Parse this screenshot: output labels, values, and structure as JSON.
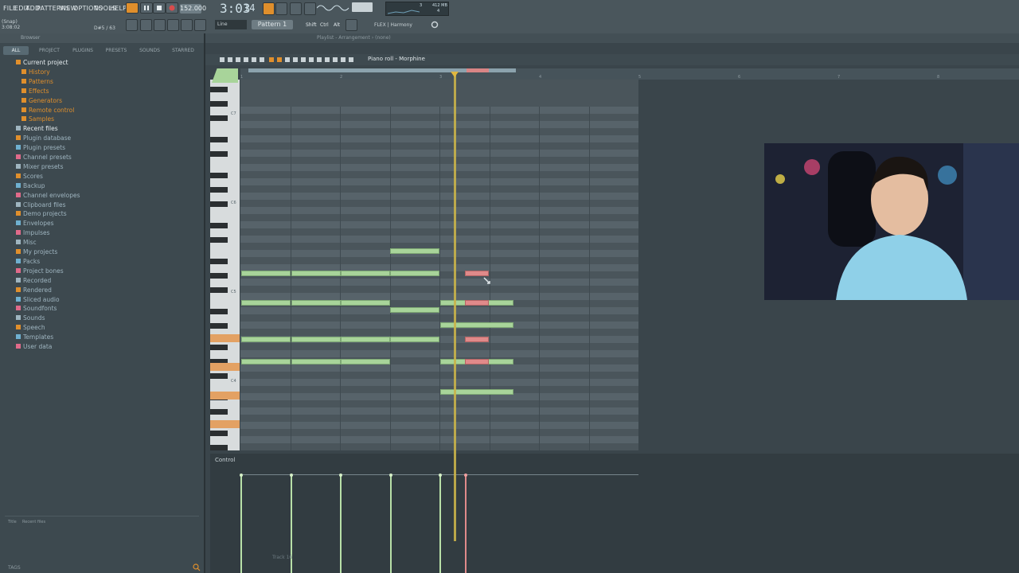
{
  "menu": [
    "FILE",
    "EDIT",
    "ADD",
    "PATTERNS",
    "VIEW",
    "OPTIONS",
    "TOOLS",
    "HELP"
  ],
  "transport": {
    "tempo": "152.000",
    "time": "3:03",
    "time_sub": "14",
    "cpu": "3",
    "ram": "412 MB",
    "voices": "4"
  },
  "pattern_label": "Pattern 1",
  "snap_label": "Line",
  "hint": {
    "line1": "(Snap)",
    "line2": "3:08:02",
    "value": "D#5 / 63"
  },
  "toolbar_keys": [
    "Shift",
    "Ctrl",
    "Alt"
  ],
  "flex_label": "FLEX | Harmony",
  "browser": {
    "title": "Browser",
    "tabs": [
      "ALL",
      "PROJECT",
      "PLUGINS",
      "PRESETS",
      "SOUNDS",
      "STARRED"
    ],
    "items": [
      {
        "label": "Current project",
        "level": 0,
        "color": "#e08f2c"
      },
      {
        "label": "History",
        "level": 1
      },
      {
        "label": "Patterns",
        "level": 1
      },
      {
        "label": "Effects",
        "level": 1
      },
      {
        "label": "Generators",
        "level": 1
      },
      {
        "label": "Remote control",
        "level": 1
      },
      {
        "label": "Samples",
        "level": 1
      },
      {
        "label": "Recent files",
        "level": 0
      },
      {
        "label": "Plugin database",
        "level": 0
      },
      {
        "label": "Plugin presets",
        "level": 0
      },
      {
        "label": "Channel presets",
        "level": 0
      },
      {
        "label": "Mixer presets",
        "level": 0
      },
      {
        "label": "Scores",
        "level": 0
      },
      {
        "label": "Backup",
        "level": 0
      },
      {
        "label": "Channel envelopes",
        "level": 0
      },
      {
        "label": "Clipboard files",
        "level": 0
      },
      {
        "label": "Demo projects",
        "level": 0
      },
      {
        "label": "Envelopes",
        "level": 0
      },
      {
        "label": "Impulses",
        "level": 0
      },
      {
        "label": "Misc",
        "level": 0
      },
      {
        "label": "My projects",
        "level": 0
      },
      {
        "label": "Packs",
        "level": 0
      },
      {
        "label": "Project bones",
        "level": 0
      },
      {
        "label": "Recorded",
        "level": 0
      },
      {
        "label": "Rendered",
        "level": 0
      },
      {
        "label": "Sliced audio",
        "level": 0
      },
      {
        "label": "Soundfonts",
        "level": 0
      },
      {
        "label": "Sounds",
        "level": 0
      },
      {
        "label": "Speech",
        "level": 0
      },
      {
        "label": "Templates",
        "level": 0
      },
      {
        "label": "User data",
        "level": 0
      }
    ],
    "footer": {
      "title": "Title",
      "recent": "Recent files",
      "tags": "TAGS"
    }
  },
  "playlist_title": "Playlist - Arrangement › (none)",
  "piano_roll": {
    "title": "Piano roll - Morphine",
    "bars": [
      "1",
      "2",
      "3",
      "4",
      "5",
      "6",
      "7",
      "8"
    ],
    "octave_labels": [
      "C7",
      "C6",
      "C5",
      "C4"
    ],
    "control_label": "Control",
    "track_label": "Track 16"
  }
}
